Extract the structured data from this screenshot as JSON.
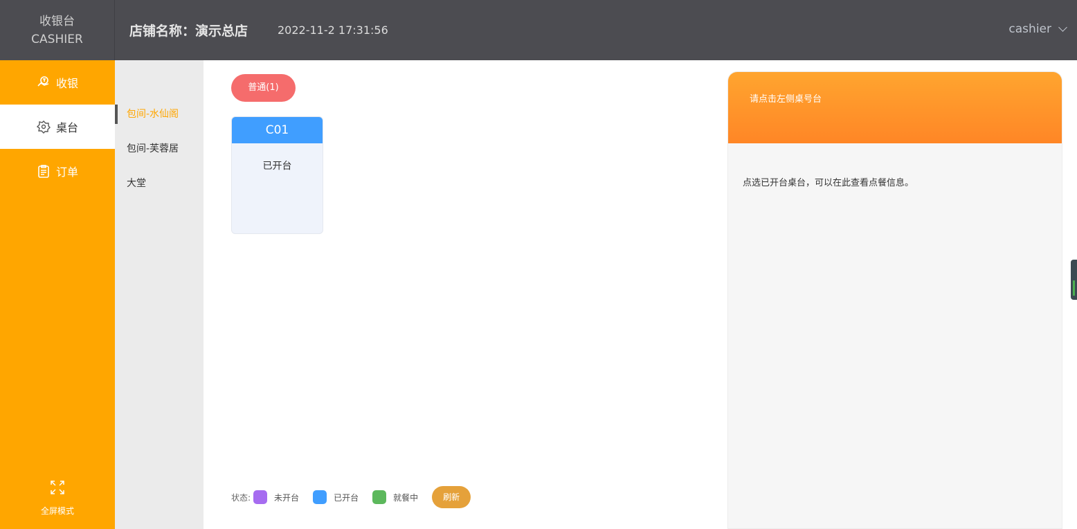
{
  "brand": {
    "line1": "收银台",
    "line2": "CASHIER"
  },
  "header": {
    "store_title": "店铺名称：演示总店",
    "datetime": "2022-11-2 17:31:56",
    "user": "cashier"
  },
  "nav": {
    "items": [
      {
        "label": "收银",
        "icon": "cashier-icon"
      },
      {
        "label": "桌台",
        "icon": "table-icon",
        "active": true
      },
      {
        "label": "订单",
        "icon": "order-icon"
      }
    ],
    "fullscreen_label": "全屏模式"
  },
  "categories": [
    {
      "label": "包间-水仙阁",
      "active": true
    },
    {
      "label": "包间-芙蓉居"
    },
    {
      "label": "大堂"
    }
  ],
  "filter_pill": "普通(1)",
  "tables": [
    {
      "name": "C01",
      "status": "已开台"
    }
  ],
  "legend": {
    "label": "状态:",
    "items": [
      {
        "label": "未开台",
        "color": "#a66cf0"
      },
      {
        "label": "已开台",
        "color": "#409eff"
      },
      {
        "label": "就餐中",
        "color": "#5cb85c"
      }
    ],
    "refresh_label": "刷新"
  },
  "right_panel": {
    "header_text": "请点击左侧桌号台",
    "body_text": "点选已开台桌台，可以在此查看点餐信息。"
  },
  "colors": {
    "accent_orange": "#ffa600",
    "header_bg": "#4c4c51",
    "table_blue": "#409eff",
    "pill_red": "#f56c6c"
  }
}
